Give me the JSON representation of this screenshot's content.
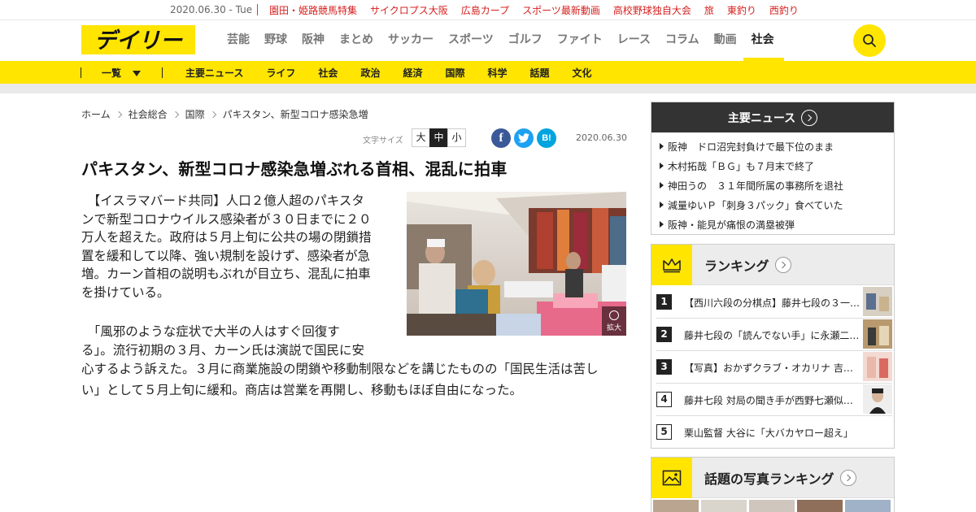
{
  "topbar": {
    "date": "2020.06.30 - Tue",
    "links": [
      "園田・姫路競馬特集",
      "サイクロプス大阪",
      "広島カープ",
      "スポーツ最新動画",
      "高校野球独自大会",
      "旅",
      "東釣り",
      "西釣り"
    ]
  },
  "header": {
    "logo_text": "デイリー",
    "nav": [
      "芸能",
      "野球",
      "阪神",
      "まとめ",
      "サッカー",
      "スポーツ",
      "ゴルフ",
      "ファイト",
      "レース",
      "コラム",
      "動画",
      "社会"
    ],
    "active_nav": "社会",
    "search_icon": "search-icon"
  },
  "catbar": {
    "list_label": "一覧",
    "items": [
      "主要ニュース",
      "ライフ",
      "社会",
      "政治",
      "経済",
      "国際",
      "科学",
      "話題",
      "文化"
    ]
  },
  "breadcrumb": [
    "ホーム",
    "社会総合",
    "国際",
    "パキスタン、新型コロナ感染急増"
  ],
  "tools": {
    "font_size_label": "文字サイズ",
    "font_sizes": [
      "大",
      "中",
      "小"
    ],
    "selected_font_size": "中",
    "share": {
      "facebook": "f",
      "twitter": "twitter-icon",
      "hatena": "B!"
    },
    "date": "2020.06.30"
  },
  "article": {
    "headline": "パキスタン、新型コロナ感染急増ぶれる首相、混乱に拍車",
    "photo_zoom_label": "拡大",
    "lines": [
      "　【イスラマバード共同】人口２億人超のパキスタ",
      "ンで新型コロナウイルス感染者が３０日までに２０",
      "万人を超えた。政府は５月上旬に公共の場の閉鎖措",
      "置を緩和して以降、強い規制を設けず、感染者が急",
      "増。カーン首相の説明もぶれが目立ち、混乱に拍車",
      "を掛けている。",
      "　「風邪のような症状で大半の人はすぐ回復す",
      "る」。流行初期の３月、カーン氏は演説で国民に安",
      "心するよう訴えた。３月に商業施設の閉鎖や移動制限などを講じたものの「国民生活は苦し",
      "い」として５月上旬に緩和。商店は営業を再開し、移動もほぼ自由になった。"
    ]
  },
  "sidebar": {
    "main_news": {
      "title": "主要ニュース",
      "items": [
        "阪神　ドロ沼完封負けで最下位のまま",
        "木村拓哉「ＢＧ」も７月末で終了",
        "神田うの　３１年間所属の事務所を退社",
        "減量ゆいＰ「刺身３パック」食べていた",
        "阪神・能見が痛恨の満塁被弾"
      ]
    },
    "ranking": {
      "title": "ランキング",
      "items": [
        {
          "rank": "1",
          "text": "【西川六段の分棋点】藤井七段の３一…"
        },
        {
          "rank": "2",
          "text": "藤井七段の「読んでない手」に永瀬二…"
        },
        {
          "rank": "3",
          "text": "【写真】おかずクラブ・オカリナ 吉…"
        },
        {
          "rank": "4",
          "text": "藤井七段 対局の聞き手が西野七瀬似…"
        },
        {
          "rank": "5",
          "text": "栗山監督 大谷に「大バカヤロー超え」"
        }
      ]
    },
    "photo_ranking": {
      "title": "話題の写真ランキング"
    }
  }
}
